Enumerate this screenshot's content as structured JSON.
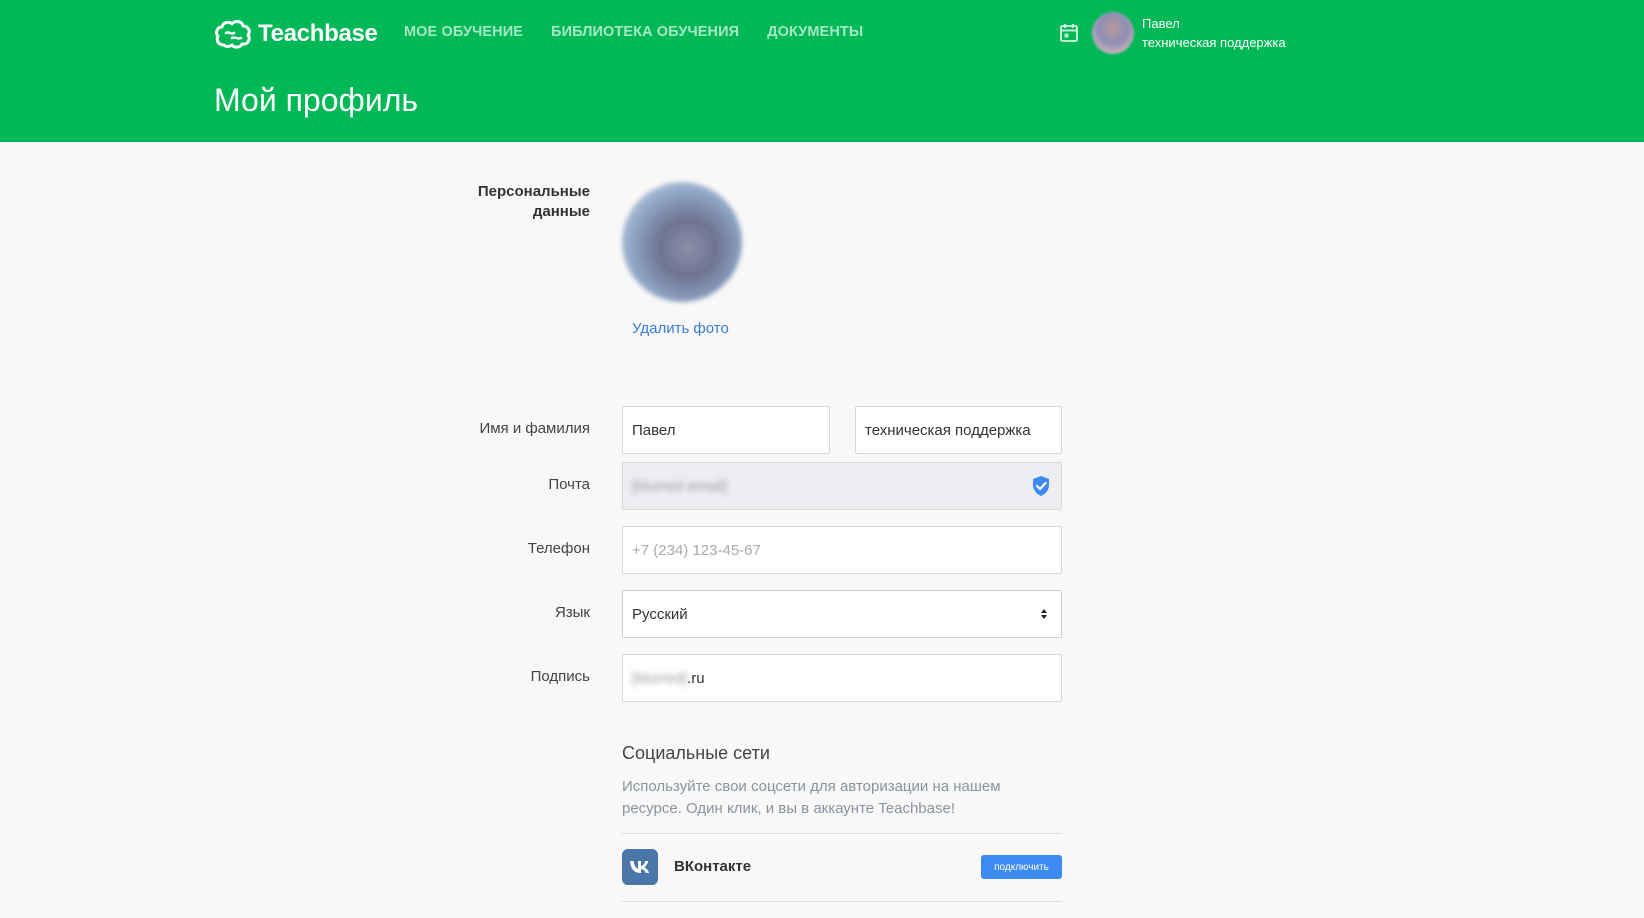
{
  "brand": {
    "name": "Teachbase"
  },
  "nav": {
    "items": [
      {
        "label": "МОЕ ОБУЧЕНИЕ"
      },
      {
        "label": "БИБЛИОТЕКА ОБУЧЕНИЯ"
      },
      {
        "label": "ДОКУМЕНТЫ"
      }
    ]
  },
  "user": {
    "first_name": "Павел",
    "last_name": "техническая поддержка"
  },
  "page": {
    "title": "Мой профиль"
  },
  "profile": {
    "section_label": "Персональные\nданные",
    "delete_photo": "Удалить фото",
    "name_label": "Имя и фамилия",
    "first_name_value": "Павел",
    "last_name_value": "техническая поддержка",
    "email_label": "Почта",
    "email_value": "[blurred email]",
    "email_verified": true,
    "phone_label": "Телефон",
    "phone_placeholder": "+7 (234) 123-45-67",
    "language_label": "Язык",
    "language_value": "Русский",
    "signature_label": "Подпись",
    "signature_blurred": "[blurred]",
    "signature_suffix": ".ru"
  },
  "social": {
    "title": "Социальные сети",
    "description": "Используйте свои соцсети для авторизации на нашем ресурсе. Один клик, и вы в аккаунте Teachbase!",
    "networks": [
      {
        "name": "ВКонтакте",
        "button_label": "подключить"
      }
    ]
  },
  "colors": {
    "header": "#00b956",
    "link": "#3a7bd5",
    "button": "#3d8bf2",
    "vk": "#4a76a8"
  },
  "icons": [
    "brain-logo-icon",
    "calendar-icon",
    "shield-check-icon",
    "select-arrows-icon",
    "vk-icon"
  ]
}
